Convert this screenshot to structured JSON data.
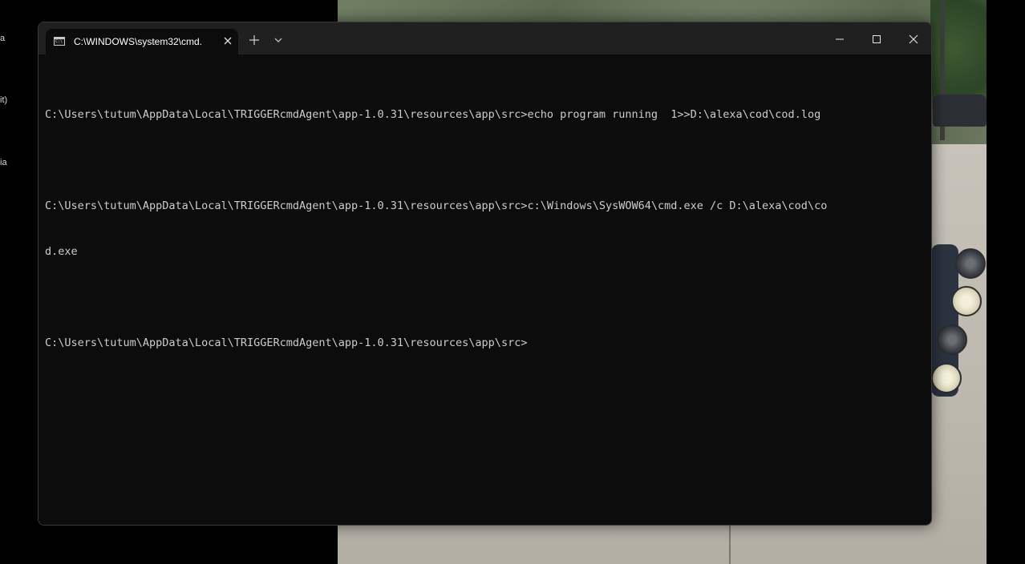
{
  "desktop": {
    "edge_labels": [
      "a",
      "it)",
      "ia"
    ]
  },
  "window": {
    "tab_title": "C:\\WINDOWS\\system32\\cmd.",
    "tab_icon": "cmd-icon",
    "close_tab_icon": "close-icon",
    "new_tab_icon": "plus-icon",
    "dropdown_icon": "chevron-down-icon",
    "controls": {
      "minimize_icon": "minimize-icon",
      "maximize_icon": "maximize-icon",
      "close_icon": "close-icon"
    }
  },
  "console": {
    "lines": [
      "C:\\Users\\tutum\\AppData\\Local\\TRIGGERcmdAgent\\app-1.0.31\\resources\\app\\src>echo program running  1>>D:\\alexa\\cod\\cod.log",
      "",
      "C:\\Users\\tutum\\AppData\\Local\\TRIGGERcmdAgent\\app-1.0.31\\resources\\app\\src>c:\\Windows\\SysWOW64\\cmd.exe /c D:\\alexa\\cod\\co",
      "d.exe",
      "",
      "C:\\Users\\tutum\\AppData\\Local\\TRIGGERcmdAgent\\app-1.0.31\\resources\\app\\src>"
    ]
  },
  "colors": {
    "console_bg": "#0c0c0c",
    "console_text": "#cccccc",
    "titlebar_bg": "#202020"
  }
}
